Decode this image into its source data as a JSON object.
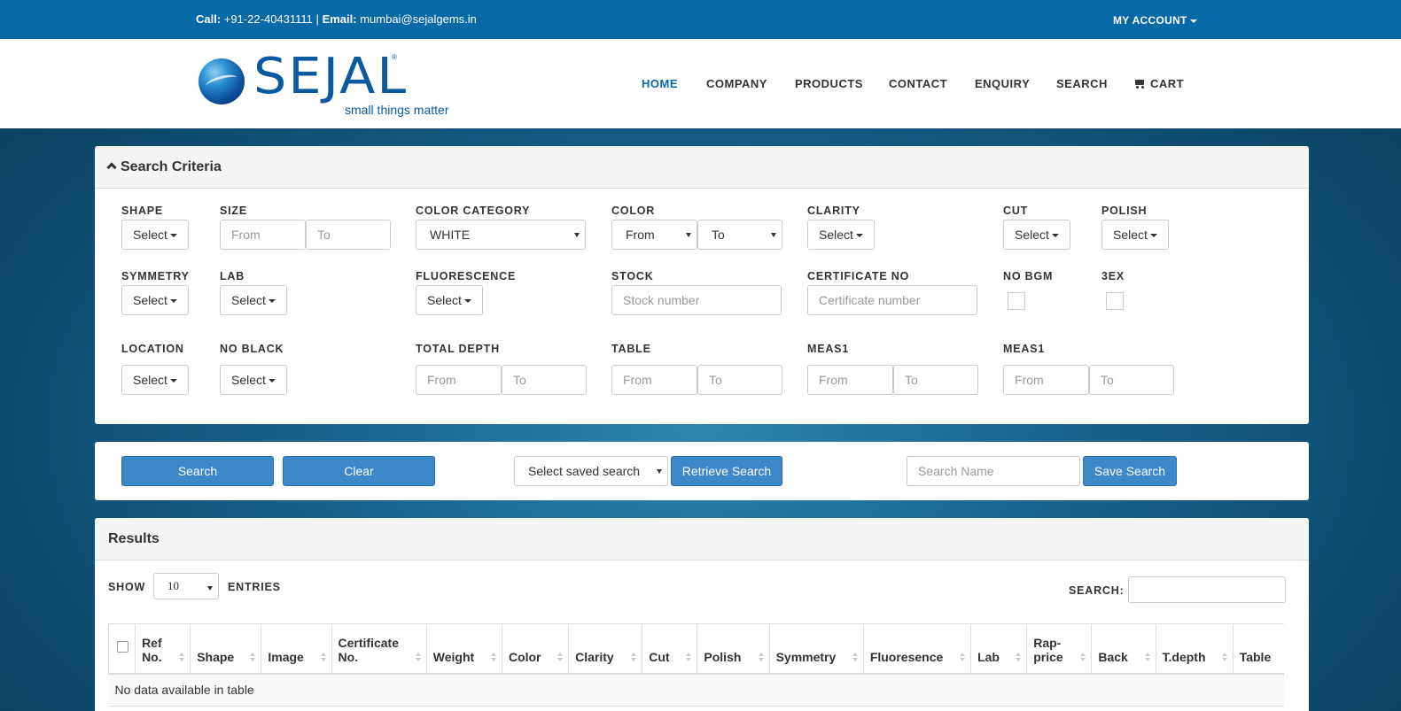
{
  "topbar": {
    "call_label": "Call:",
    "call_value": "+91-22-40431111",
    "separator": "|",
    "email_label": "Email:",
    "email_value": "mumbai@sejalgems.in",
    "account": "MY ACCOUNT"
  },
  "logo": {
    "word": "SEJAL",
    "reg": "®",
    "tagline": "small things matter"
  },
  "nav": [
    "HOME",
    "COMPANY",
    "PRODUCTS",
    "CONTACT",
    "ENQUIRY",
    "SEARCH",
    "CART"
  ],
  "criteria": {
    "title": "Search Criteria",
    "labels": {
      "shape": "SHAPE",
      "size": "SIZE",
      "color_category": "COLOR CATEGORY",
      "color": "COLOR",
      "clarity": "CLARITY",
      "cut": "CUT",
      "polish": "POLISH",
      "symmetry": "SYMMETRY",
      "lab": "LAB",
      "fluorescence": "FLUORESCENCE",
      "stock": "STOCK",
      "certificate": "CERTIFICATE NO",
      "no_bgm": "NO BGM",
      "three_ex": "3EX",
      "location": "LOCATION",
      "no_black": "NO BLACK",
      "total_depth": "TOTAL DEPTH",
      "table": "TABLE",
      "meas1_a": "MEAS1",
      "meas1_b": "MEAS1"
    },
    "select": "Select",
    "from": "From",
    "to": "To",
    "color_category_value": "WHITE",
    "color_from": "From",
    "color_to": "To",
    "stock_placeholder": "Stock number",
    "certificate_placeholder": "Certificate number"
  },
  "actions": {
    "search": "Search",
    "clear": "Clear",
    "saved_search": "Select saved search",
    "retrieve": "Retrieve Search",
    "search_name_placeholder": "Search Name",
    "save": "Save Search"
  },
  "results": {
    "title": "Results",
    "show": "SHOW",
    "entries_value": "10",
    "entries": "ENTRIES",
    "search_label": "SEARCH:",
    "columns": [
      "Ref No.",
      "Shape",
      "Image",
      "Certificate No.",
      "Weight",
      "Color",
      "Clarity",
      "Cut",
      "Polish",
      "Symmetry",
      "Fluoresence",
      "Lab",
      "Rap-price",
      "Back",
      "T.depth",
      "Table"
    ],
    "empty": "No data available in table"
  }
}
